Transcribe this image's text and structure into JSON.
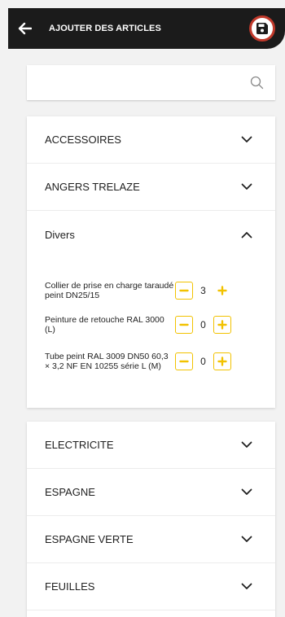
{
  "header": {
    "title": "AJOUTER DES ARTICLES"
  },
  "search": {
    "placeholder": "",
    "value": ""
  },
  "categories_top": [
    {
      "label": "ACCESSOIRES",
      "expanded": false
    },
    {
      "label": "ANGERS TRELAZE",
      "expanded": false
    },
    {
      "label": "Divers",
      "expanded": true
    }
  ],
  "divers_items": [
    {
      "label": "Collier de prise en charge taraudé peint DN25/15",
      "quantity": "3"
    },
    {
      "label": "Peinture de retouche RAL 3000 (L)",
      "quantity": "0"
    },
    {
      "label": "Tube peint RAL 3009 DN50 60,3 × 3,2 NF EN 10255 série L (M)",
      "quantity": "0"
    }
  ],
  "categories_bottom": [
    {
      "label": "ELECTRICITE",
      "expanded": false
    },
    {
      "label": "ESPAGNE",
      "expanded": false
    },
    {
      "label": "ESPAGNE VERTE",
      "expanded": false
    },
    {
      "label": "FEUILLES",
      "expanded": false
    }
  ],
  "colors": {
    "header_bg": "#1b1b1b",
    "accent_yellow": "#f2c200",
    "save_ring": "#c0392b"
  },
  "icons": {
    "back": "arrow-left-icon",
    "save": "floppy-disk-icon",
    "search": "search-icon",
    "expand": "chevron-down-icon",
    "collapse": "chevron-up-icon",
    "minus": "minus-icon",
    "plus": "plus-icon"
  }
}
